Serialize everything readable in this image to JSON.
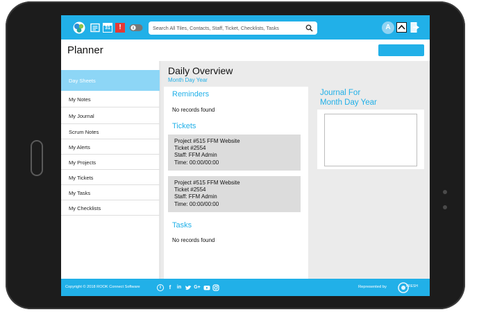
{
  "header": {
    "search_placeholder": "Search All Tiles, Contacts, Staff, Ticket, Checklists, Tasks",
    "calendar_day": "31",
    "alert_glyph": "!",
    "avatar_initial": "A",
    "accent_color": "#21b0e8"
  },
  "page": {
    "title": "Planner"
  },
  "sidebar": {
    "items": [
      {
        "label": "Day Sheets",
        "active": true
      },
      {
        "label": "My Notes"
      },
      {
        "label": "My Journal"
      },
      {
        "label": "Scrum Notes"
      },
      {
        "label": "My Alerts"
      },
      {
        "label": "My Projects"
      },
      {
        "label": "My Tickets"
      },
      {
        "label": "My Tasks"
      },
      {
        "label": "My Checklists"
      }
    ]
  },
  "overview": {
    "title": "Daily Overview",
    "subtitle": "Month Day Year",
    "reminders": {
      "title": "Reminders",
      "empty": "No records found"
    },
    "tickets": {
      "title": "Tickets",
      "items": [
        {
          "project": "Project #515 FFM Website",
          "ticket": "Ticket #2554",
          "staff": "Staff: FFM Admin",
          "time": "Time: 00:00/00:00"
        },
        {
          "project": "Project #515 FFM Website",
          "ticket": "Ticket #2554",
          "staff": "Staff: FFM Admin",
          "time": "Time: 00:00/00:00"
        }
      ]
    },
    "tasks": {
      "title": "Tasks",
      "empty": "No records found"
    }
  },
  "journal": {
    "title_line1": "Journal For",
    "title_line2": "Month Day Year"
  },
  "footer": {
    "copyright": "Copyright © 2018 ROOK Connect Software",
    "represented_by": "Represented by",
    "partner_logo_text": "FRESH"
  },
  "icons": {
    "logo": "colorful-circles-logo",
    "notes": "notes-icon",
    "calendar": "calendar-icon",
    "alert": "alert-icon",
    "toggle": "toggle-icon",
    "search": "search-icon",
    "chevron": "chevron-up-icon",
    "logout": "logout-icon",
    "social": [
      "info-icon",
      "facebook-icon",
      "linkedin-icon",
      "twitter-icon",
      "google-plus-icon",
      "youtube-icon",
      "instagram-icon"
    ]
  }
}
